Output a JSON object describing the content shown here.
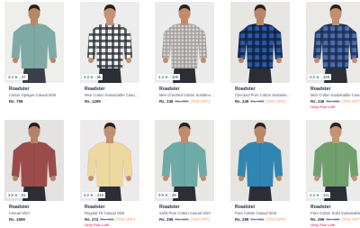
{
  "products": [
    {
      "rating": "4.4",
      "count": "47",
      "brand": "Roadster",
      "title": "Cotton Opaque Casual Shirt",
      "price": "Rs. 799",
      "mrp": "",
      "off": "",
      "left": "",
      "bg": "#eeeeec",
      "shirt": "#7fa9a5",
      "pattern": "plain",
      "pant": "#3a3f4a",
      "skin": "#b88765"
    },
    {
      "rating": "4.3",
      "count": "5k",
      "brand": "Roadster",
      "title": "Men Cotton Sustainable Casual Shirt",
      "price": "Rs. 1299",
      "mrp": "",
      "off": "",
      "left": "",
      "bg": "#ededee",
      "shirt": "#f4f4f4",
      "pattern": "check-dark",
      "pant": "#2b2e37",
      "skin": "#c59273"
    },
    {
      "rating": "4.3",
      "count": "106",
      "brand": "Roadster",
      "title": "Men Checked Cotton Sustainable Casual",
      "price": "Rs. 249",
      "mrp": "Rs. 999",
      "off": "(75% OFF)",
      "left": "",
      "bg": "#ececec",
      "shirt": "#c9c5c3",
      "pattern": "check-light",
      "pant": "#2b2e37",
      "skin": "#c18c6b"
    },
    {
      "rating": "",
      "count": "",
      "brand": "Roadster",
      "title": "Checked Pure Cotton Sustainable Casual",
      "price": "Rs. 249",
      "mrp": "Rs. 999",
      "off": "(75% OFF)",
      "left": "",
      "bg": "#e7e6e3",
      "shirt": "#2c5aa5",
      "pattern": "check-blue",
      "pant": "#2b2e37",
      "skin": "#b7876a"
    },
    {
      "rating": "4.2",
      "count": "228",
      "brand": "Roadster",
      "title": "Men Cotton Sustainable Casual Shirt",
      "price": "Rs. 249",
      "mrp": "Rs. 999",
      "off": "(75% OFF)",
      "left": "Only Few Left!",
      "bg": "#eae9e6",
      "shirt": "#355896",
      "pattern": "check-navy",
      "pant": "#2b2e37",
      "skin": "#c28f6e"
    },
    {
      "rating": "3.8",
      "count": "51",
      "brand": "Roadster",
      "title": "Casual Shirt",
      "price": "Rs. 1599",
      "mrp": "",
      "off": "",
      "left": "",
      "bg": "#e4e3e1",
      "shirt": "#9b4c4a",
      "pattern": "plain",
      "pant": "#2b2e37",
      "skin": "#b48366"
    },
    {
      "rating": "4.2",
      "count": "415",
      "brand": "Roadster",
      "title": "Regular Fit Casual Shirt",
      "price": "Rs. 274",
      "mrp": "Rs. 999",
      "off": "(73% OFF)",
      "left": "Only Few Left!",
      "bg": "#eceaeb",
      "shirt": "#edd9a0",
      "pattern": "plain",
      "pant": "#2b2e37",
      "skin": "#c3906f"
    },
    {
      "rating": "3.9",
      "count": "29",
      "brand": "Roadster",
      "title": "Solid Pure Cotton Casual Shirt",
      "price": "Rs. 299",
      "mrp": "Rs. 999",
      "off": "(70% OFF)",
      "left": "",
      "bg": "#e8e7e4",
      "shirt": "#6faba6",
      "pattern": "plain",
      "pant": "#2b2e37",
      "skin": "#c18c6b"
    },
    {
      "rating": "",
      "count": "",
      "brand": "Roadster",
      "title": "Pure Cotton Casual Shirt",
      "price": "Rs. 299",
      "mrp": "Rs. 999",
      "off": "(70% OFF)",
      "left": "",
      "bg": "#e6e4e0",
      "shirt": "#2f86b3",
      "pattern": "plain",
      "pant": "#2b2e37",
      "skin": "#b98868"
    },
    {
      "rating": "4.4",
      "count": "111",
      "brand": "Roadster",
      "title": "Pure Cotton Solid Sustainable",
      "price": "Rs. 299",
      "mrp": "Rs. 999",
      "off": "(70% OFF)",
      "left": "Only Few Left!",
      "bg": "#ebebea",
      "shirt": "#6fa06c",
      "pattern": "plain",
      "pant": "#2b2e37",
      "skin": "#c69373"
    }
  ]
}
